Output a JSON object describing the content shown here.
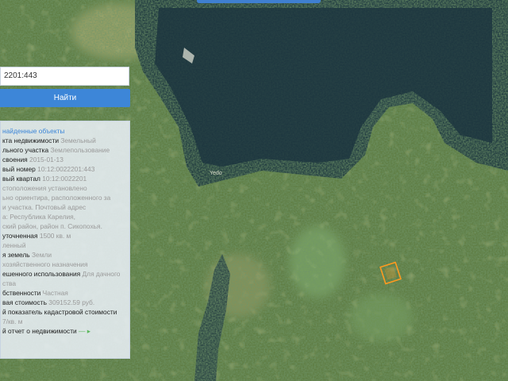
{
  "search": {
    "value": "2201:443"
  },
  "find_button": {
    "label": "Найти"
  },
  "panel": {
    "header": "найденные объекты",
    "rows": [
      {
        "k": "кта недвижимости",
        "v": " Земельный"
      },
      {
        "k": "",
        "v": ""
      },
      {
        "k": "льного участка",
        "v": " Землепользование"
      },
      {
        "k": "своения",
        "v": " 2015-01-13"
      },
      {
        "k": "вый номер",
        "v": " 10:12:0022201:443"
      },
      {
        "k": "вый квартал",
        "v": " 10:12:0022201"
      },
      {
        "k": "",
        "v": "стоположения установлено"
      },
      {
        "k": "",
        "v": "ьно ориентира, расположенного за"
      },
      {
        "k": "",
        "v": "и участка. Почтовый адрес"
      },
      {
        "k": "",
        "v": "а: Республика Карелия,"
      },
      {
        "k": "",
        "v": "ский район, район п. Сикопохья."
      },
      {
        "k": " уточненная",
        "v": " 1500 кв. м"
      },
      {
        "k": "",
        "v": "ленный"
      },
      {
        "k": "я земель",
        "v": " Земли"
      },
      {
        "k": "",
        "v": "хозяйственного назначения"
      },
      {
        "k": "ешенного использования",
        "v": " Для дачного"
      },
      {
        "k": "",
        "v": "ства"
      },
      {
        "k": "бственности",
        "v": " Частная"
      },
      {
        "k": "вая стоимость",
        "v": " 309152.59 руб."
      },
      {
        "k": "й показатель кадастровой стоимости",
        "v": ""
      },
      {
        "k": "",
        "v": "7/кв. м"
      },
      {
        "k": "",
        "v": ""
      },
      {
        "k": "й отчет о недвижимости",
        "v": ""
      }
    ]
  },
  "map": {
    "label": "Yedo"
  },
  "colors": {
    "accent": "#3d86d8",
    "water": "#203a45",
    "parcel": "#ff9a1f"
  }
}
